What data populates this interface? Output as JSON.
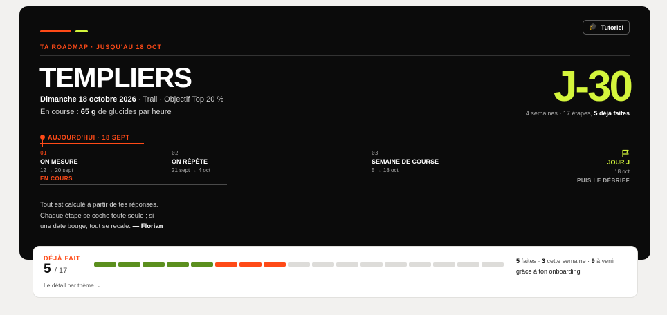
{
  "header": {
    "eyebrow": "TA ROADMAP · JUSQU'AU 18 OCT",
    "tutorial_label": "Tutoriel",
    "accent_primary": "#ff4a17",
    "accent_secondary": "#d4f53c"
  },
  "race": {
    "name": "TEMPLIERS",
    "date": "Dimanche 18 octobre 2026",
    "details": "· Trail · Objectif Top 20 %",
    "carbs_prefix": "En course : ",
    "carbs_value": "65 g",
    "carbs_suffix": " de glucides par heure"
  },
  "countdown": {
    "label": "J-30",
    "meta": "4 semaines · 17 étapes, ",
    "meta_done": "5 déjà faites"
  },
  "today": {
    "label": "AUJOURD'HUI · 18 SEPT"
  },
  "phases": [
    {
      "num": "01",
      "name": "ON MESURE",
      "dates": "12 → 20 sept",
      "status": "EN COURS"
    },
    {
      "num": "02",
      "name": "ON RÉPÈTE",
      "dates": "21 sept → 4 oct"
    },
    {
      "num": "03",
      "name": "SEMAINE DE COURSE",
      "dates": "5 → 18 oct"
    }
  ],
  "race_day": {
    "name": "JOUR J",
    "date": "18 oct",
    "after": "PUIS LE DÉBRIEF"
  },
  "note": {
    "line1": "Tout est calculé à partir de tes réponses.",
    "line2": "Chaque étape se coche toute seule ; si",
    "line3": "une date bouge, tout se recale. ",
    "signature": "— Florian"
  },
  "progress": {
    "label": "DÉJÀ FAIT",
    "done": "5",
    "total": "/ 17",
    "detail_label": "Le détail par thème",
    "done_count": 5,
    "week_count": 3,
    "total_count": 17,
    "summary_done": "5",
    "summary_done_label": " faites · ",
    "summary_week": "3",
    "summary_week_label": " cette semaine · ",
    "summary_todo": "9",
    "summary_todo_label": " à venir",
    "summary_line2": "grâce à ton onboarding",
    "color_done": "#5b8f1e",
    "color_week": "#ff4a17",
    "color_todo": "#dddcd9"
  }
}
